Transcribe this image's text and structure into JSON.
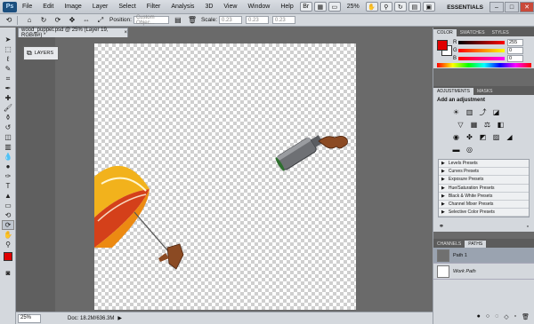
{
  "menubar": {
    "logo": "Ps",
    "items": [
      "File",
      "Edit",
      "Image",
      "Layer",
      "Select",
      "Filter",
      "Analysis",
      "3D",
      "View",
      "Window",
      "Help"
    ],
    "zoom": "25%",
    "workspace": "ESSENTIALS"
  },
  "options": {
    "position_label": "Position:",
    "position_value": "Custom Objec...",
    "scale_label": "Scale:",
    "scale_x": "0.23",
    "scale_y": "0.23",
    "scale_z": "0.23"
  },
  "document": {
    "tab_title": "wood_puppet.psd @ 25% (Layer 19, RGB/8#) *"
  },
  "dock": {
    "layers_label": "LAYERS"
  },
  "status": {
    "zoom": "25%",
    "doc_info": "Doc: 18.2M/636.3M"
  },
  "color_panel": {
    "tabs": [
      "COLOR",
      "SWATCHES",
      "STYLES"
    ],
    "fg_color": "#e00000",
    "r_label": "R",
    "g_label": "G",
    "b_label": "B",
    "r": "255",
    "g": "0",
    "b": "0"
  },
  "adjustments": {
    "tabs": [
      "ADJUSTMENTS",
      "MASKS"
    ],
    "title": "Add an adjustment",
    "presets": [
      "Levels Presets",
      "Curves Presets",
      "Exposure Presets",
      "Hue/Saturation Presets",
      "Black & White Presets",
      "Channel Mixer Presets",
      "Selective Color Presets"
    ]
  },
  "paths_panel": {
    "tabs": [
      "CHANNELS",
      "PATHS"
    ],
    "rows": [
      "Path 1",
      "Work Path"
    ]
  }
}
